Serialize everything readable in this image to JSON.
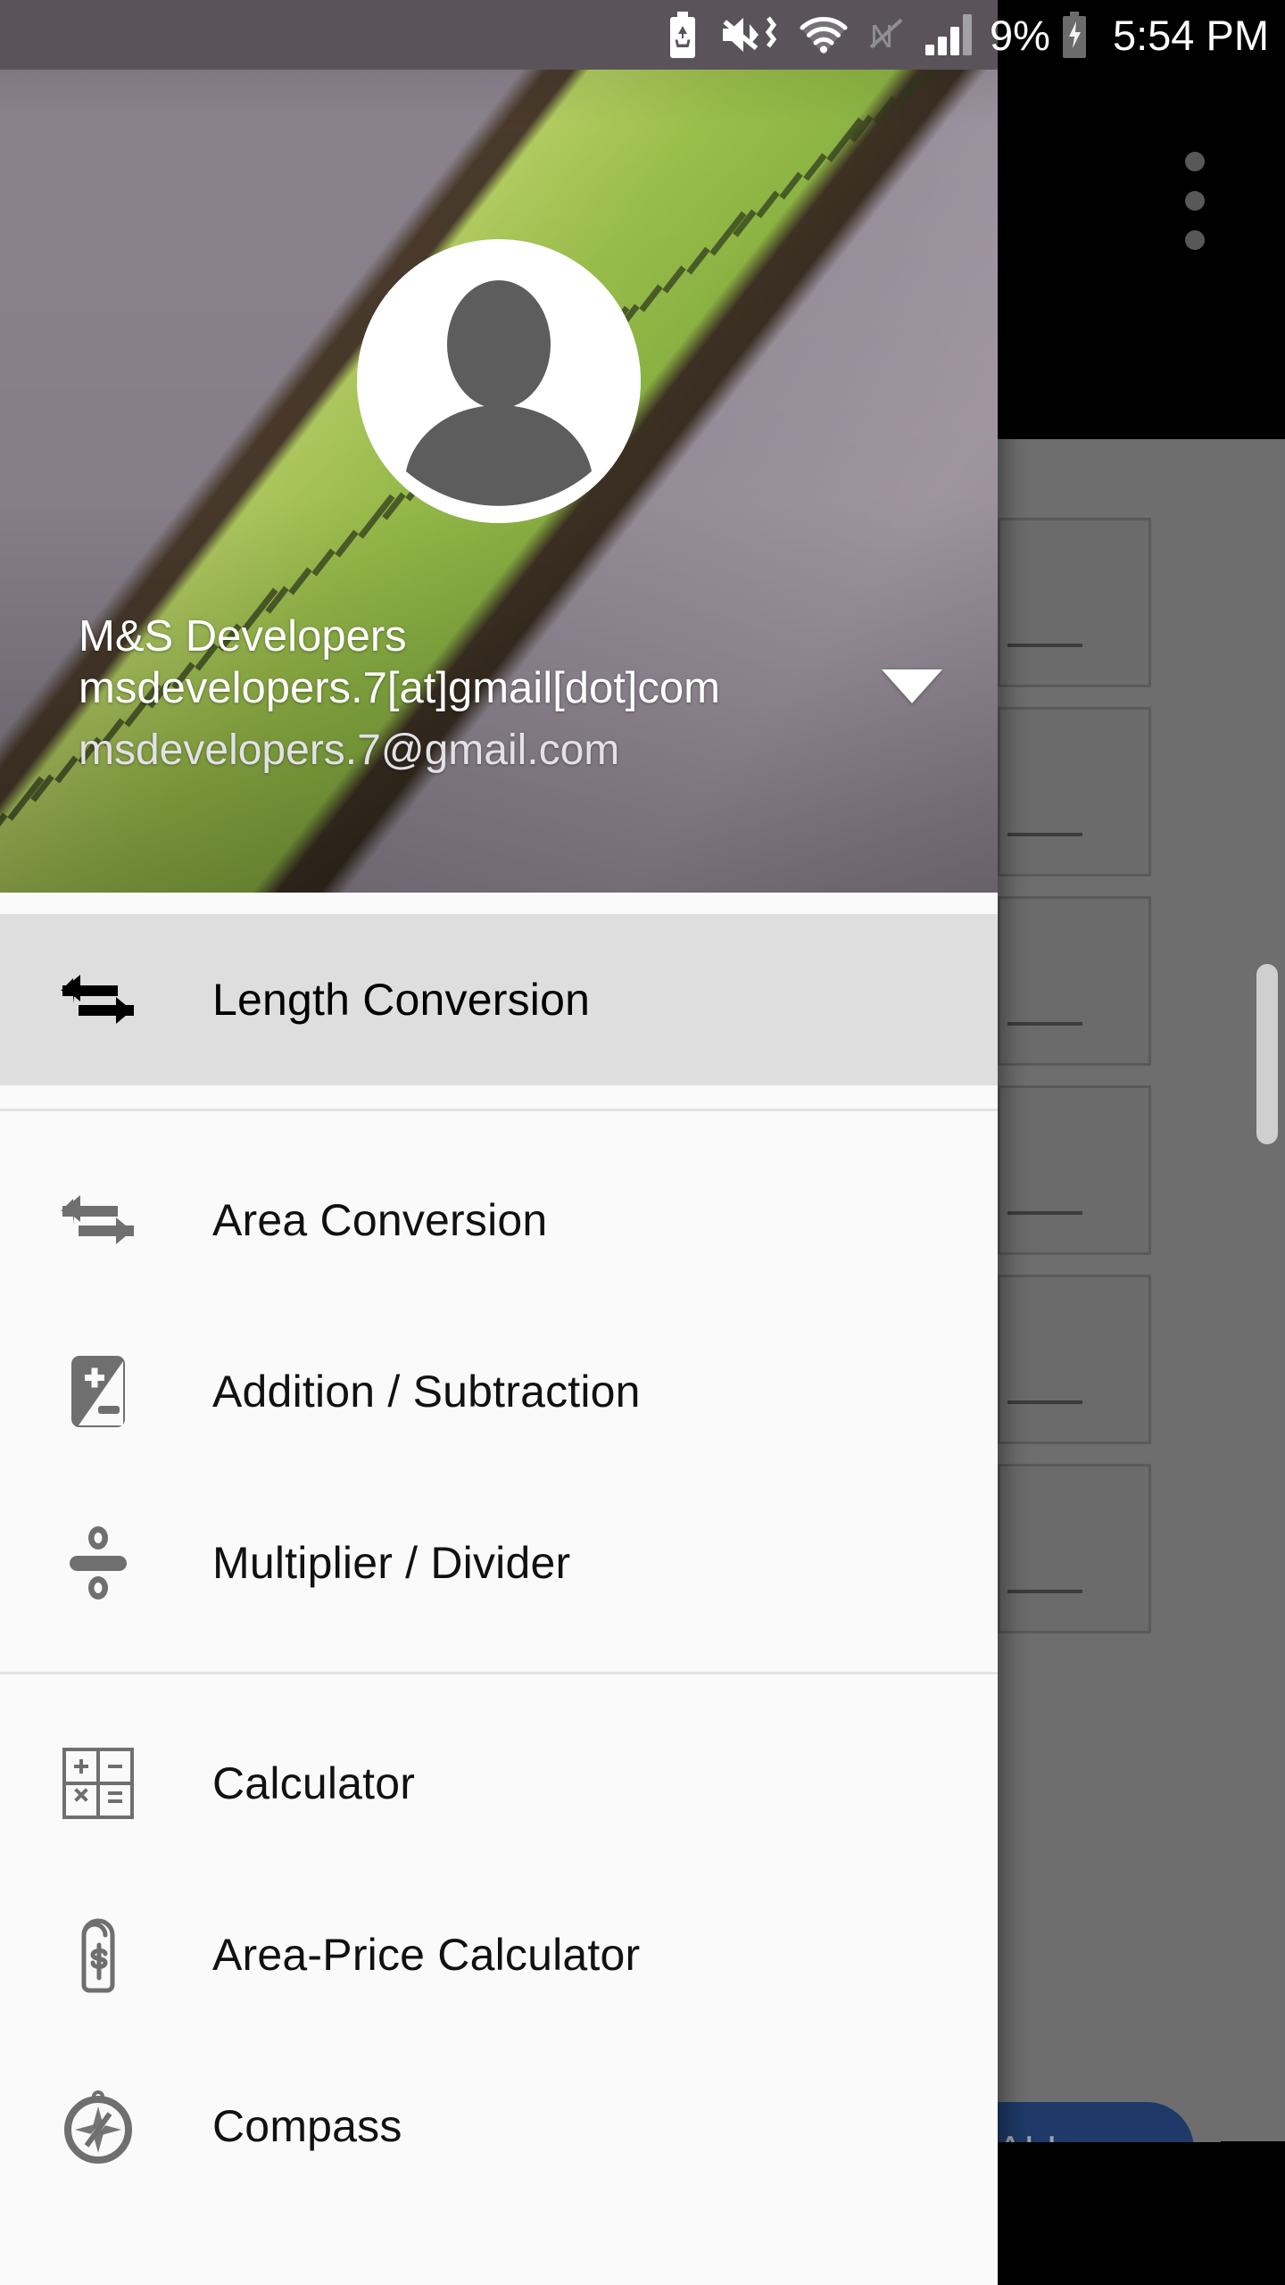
{
  "statusbar": {
    "icons": [
      "battery-saver-icon",
      "mute-vibrate-icon",
      "wifi-icon",
      "nfc-off-icon",
      "signal-icon"
    ],
    "battery_percent": "9%",
    "battery_state": "charging",
    "time": "5:54 PM"
  },
  "background_app": {
    "overflow_menu": "more-options",
    "install_button_label": "INSTALL",
    "install_button_color": "#1f3a68",
    "scrim_color": "#6e6e6e"
  },
  "drawer": {
    "account": {
      "name": "M&S Developers msdevelopers.7[at]gmail[dot]com",
      "email": "msdevelopers.7@gmail.com",
      "avatar": "default-person-avatar",
      "expand_caret": "chevron-down-icon"
    },
    "items": [
      {
        "label": "Length Conversion",
        "icon": "swap-horizontal-icon",
        "selected": true,
        "group": 0
      },
      {
        "label": "Area Conversion",
        "icon": "swap-horizontal-icon",
        "selected": false,
        "group": 1
      },
      {
        "label": "Addition / Subtraction",
        "icon": "plus-minus-box-icon",
        "selected": false,
        "group": 1
      },
      {
        "label": "Multiplier / Divider",
        "icon": "divide-icon",
        "selected": false,
        "group": 1
      },
      {
        "label": "Calculator",
        "icon": "calculator-grid-icon",
        "selected": false,
        "group": 2
      },
      {
        "label": "Area-Price Calculator",
        "icon": "price-tag-icon",
        "selected": false,
        "group": 2
      },
      {
        "label": "Compass",
        "icon": "compass-icon",
        "selected": false,
        "group": 2
      }
    ],
    "selected_bg": "#dedede",
    "bg": "#fafafa"
  }
}
